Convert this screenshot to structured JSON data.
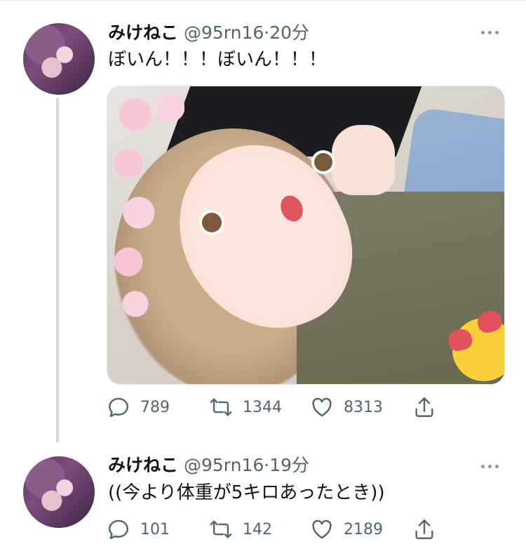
{
  "colors": {
    "text": "#0f1419",
    "secondary": "#536471",
    "thread_line": "#cfd9de"
  },
  "tweets": [
    {
      "name": "みけねこ",
      "handle": "@95rn16",
      "separator": "·",
      "time": "20分",
      "text": "ぼいん！！！ぼいん！！！",
      "has_photo": true,
      "stats": {
        "replies": "789",
        "retweets": "1344",
        "likes": "8313"
      }
    },
    {
      "name": "みけねこ",
      "handle": "@95rn16",
      "separator": "·",
      "time": "19分",
      "text": "((今より体重が5キロあったとき))",
      "has_photo": false,
      "stats": {
        "replies": "101",
        "retweets": "142",
        "likes": "2189"
      }
    }
  ],
  "icons": {
    "reply": "reply-icon",
    "retweet": "retweet-icon",
    "like": "heart-icon",
    "share": "share-icon",
    "more": "more-options-icon"
  }
}
